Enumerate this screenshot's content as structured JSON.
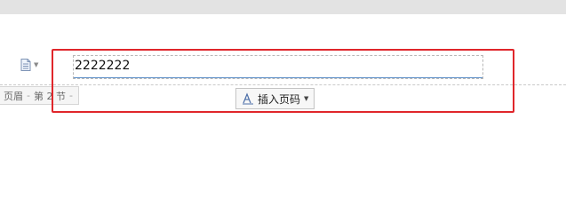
{
  "header_editor": {
    "tag_label": "页眉",
    "tag_separator": "-",
    "section_label": "第 2 节",
    "text_value": "2222222",
    "insert_page_number_label": "插入页码"
  },
  "colors": {
    "highlight": "#e0262b",
    "cursor_line": "#5b8ec7"
  },
  "icons": [
    "document-icon",
    "chevron-down-icon",
    "page-number-icon"
  ]
}
